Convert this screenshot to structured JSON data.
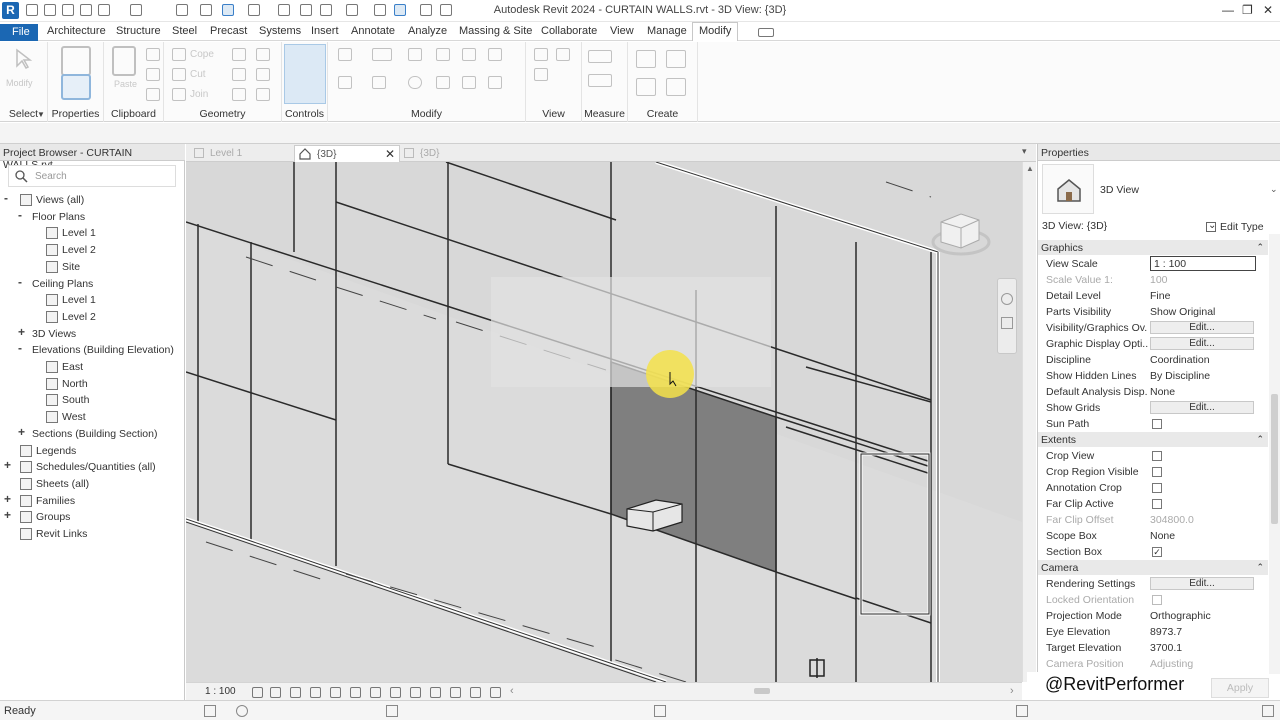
{
  "window": {
    "title": "Autodesk Revit 2024 - CURTAIN WALLS.rvt - 3D View: {3D}",
    "logo": "R"
  },
  "menu": {
    "tabs": [
      "File",
      "Architecture",
      "Structure",
      "Steel",
      "Precast",
      "Systems",
      "Insert",
      "Annotate",
      "Analyze",
      "Massing & Site",
      "Collaborate",
      "View",
      "Manage",
      "Modify"
    ],
    "active": "Modify"
  },
  "ribbon": {
    "panels": [
      "Select",
      "Properties",
      "Clipboard",
      "Geometry",
      "Controls",
      "Modify",
      "View",
      "Measure",
      "Create"
    ],
    "ribbon_texts": [
      "Modify",
      "Paste",
      "Cope",
      "Cut",
      "Join"
    ]
  },
  "project_browser": {
    "title": "Project Browser - CURTAIN WALLS.rvt",
    "search_placeholder": "Search",
    "tree": [
      {
        "label": "Views (all)",
        "level": 0,
        "toggle": "-"
      },
      {
        "label": "Floor Plans",
        "level": 1,
        "toggle": "-"
      },
      {
        "label": "Level 1",
        "level": 2,
        "toggle": ""
      },
      {
        "label": "Level 2",
        "level": 2,
        "toggle": ""
      },
      {
        "label": "Site",
        "level": 2,
        "toggle": ""
      },
      {
        "label": "Ceiling Plans",
        "level": 1,
        "toggle": "-"
      },
      {
        "label": "Level 1",
        "level": 2,
        "toggle": ""
      },
      {
        "label": "Level 2",
        "level": 2,
        "toggle": ""
      },
      {
        "label": "3D Views",
        "level": 1,
        "toggle": "+"
      },
      {
        "label": "Elevations (Building Elevation)",
        "level": 1,
        "toggle": "-"
      },
      {
        "label": "East",
        "level": 2,
        "toggle": ""
      },
      {
        "label": "North",
        "level": 2,
        "toggle": ""
      },
      {
        "label": "South",
        "level": 2,
        "toggle": ""
      },
      {
        "label": "West",
        "level": 2,
        "toggle": ""
      },
      {
        "label": "Sections (Building Section)",
        "level": 1,
        "toggle": "+"
      },
      {
        "label": "Legends",
        "level": 0,
        "toggle": ""
      },
      {
        "label": "Schedules/Quantities (all)",
        "level": 0,
        "toggle": "+"
      },
      {
        "label": "Sheets (all)",
        "level": 0,
        "toggle": ""
      },
      {
        "label": "Families",
        "level": 0,
        "toggle": "+"
      },
      {
        "label": "Groups",
        "level": 0,
        "toggle": "+"
      },
      {
        "label": "Revit Links",
        "level": 0,
        "toggle": ""
      }
    ]
  },
  "view_tabs": [
    {
      "label": "Level 1",
      "active": false
    },
    {
      "label": "{3D}",
      "active": true
    },
    {
      "label": "{3D}",
      "active": false
    }
  ],
  "view_control": {
    "scale": "1 : 100"
  },
  "properties": {
    "title": "Properties",
    "type_name": "3D View",
    "selector": "3D View: {3D}",
    "edit_type": "Edit Type",
    "sections": [
      {
        "name": "Graphics",
        "rows": [
          {
            "name": "View Scale",
            "value": "1 : 100",
            "kind": "input"
          },
          {
            "name": "Scale Value    1:",
            "value": "100",
            "kind": "text",
            "disabled": true
          },
          {
            "name": "Detail Level",
            "value": "Fine",
            "kind": "text"
          },
          {
            "name": "Parts Visibility",
            "value": "Show Original",
            "kind": "text"
          },
          {
            "name": "Visibility/Graphics Ov...",
            "value": "Edit...",
            "kind": "button"
          },
          {
            "name": "Graphic Display Opti...",
            "value": "Edit...",
            "kind": "button"
          },
          {
            "name": "Discipline",
            "value": "Coordination",
            "kind": "text"
          },
          {
            "name": "Show Hidden Lines",
            "value": "By Discipline",
            "kind": "text"
          },
          {
            "name": "Default Analysis Disp...",
            "value": "None",
            "kind": "text"
          },
          {
            "name": "Show Grids",
            "value": "Edit...",
            "kind": "button"
          },
          {
            "name": "Sun Path",
            "value": "",
            "kind": "check",
            "checked": false
          }
        ]
      },
      {
        "name": "Extents",
        "rows": [
          {
            "name": "Crop View",
            "value": "",
            "kind": "check",
            "checked": false
          },
          {
            "name": "Crop Region Visible",
            "value": "",
            "kind": "check",
            "checked": false
          },
          {
            "name": "Annotation Crop",
            "value": "",
            "kind": "check",
            "checked": false
          },
          {
            "name": "Far Clip Active",
            "value": "",
            "kind": "check",
            "checked": false
          },
          {
            "name": "Far Clip Offset",
            "value": "304800.0",
            "kind": "text",
            "disabled": true
          },
          {
            "name": "Scope Box",
            "value": "None",
            "kind": "text"
          },
          {
            "name": "Section Box",
            "value": "",
            "kind": "check",
            "checked": true
          }
        ]
      },
      {
        "name": "Camera",
        "rows": [
          {
            "name": "Rendering Settings",
            "value": "Edit...",
            "kind": "button"
          },
          {
            "name": "Locked Orientation",
            "value": "",
            "kind": "check",
            "checked": false,
            "disabled": true
          },
          {
            "name": "Projection Mode",
            "value": "Orthographic",
            "kind": "text"
          },
          {
            "name": "Eye Elevation",
            "value": "8973.7",
            "kind": "text"
          },
          {
            "name": "Target Elevation",
            "value": "3700.1",
            "kind": "text"
          },
          {
            "name": "Camera Position",
            "value": "Adjusting",
            "kind": "text",
            "disabled": true
          }
        ]
      }
    ],
    "apply": "Apply"
  },
  "watermark": "@RevitPerformer",
  "status": {
    "text": "Ready"
  },
  "colors": {
    "accent": "#1b67b3",
    "selected_panel": "#7f7f7f",
    "highlight": "#f4e24a"
  }
}
